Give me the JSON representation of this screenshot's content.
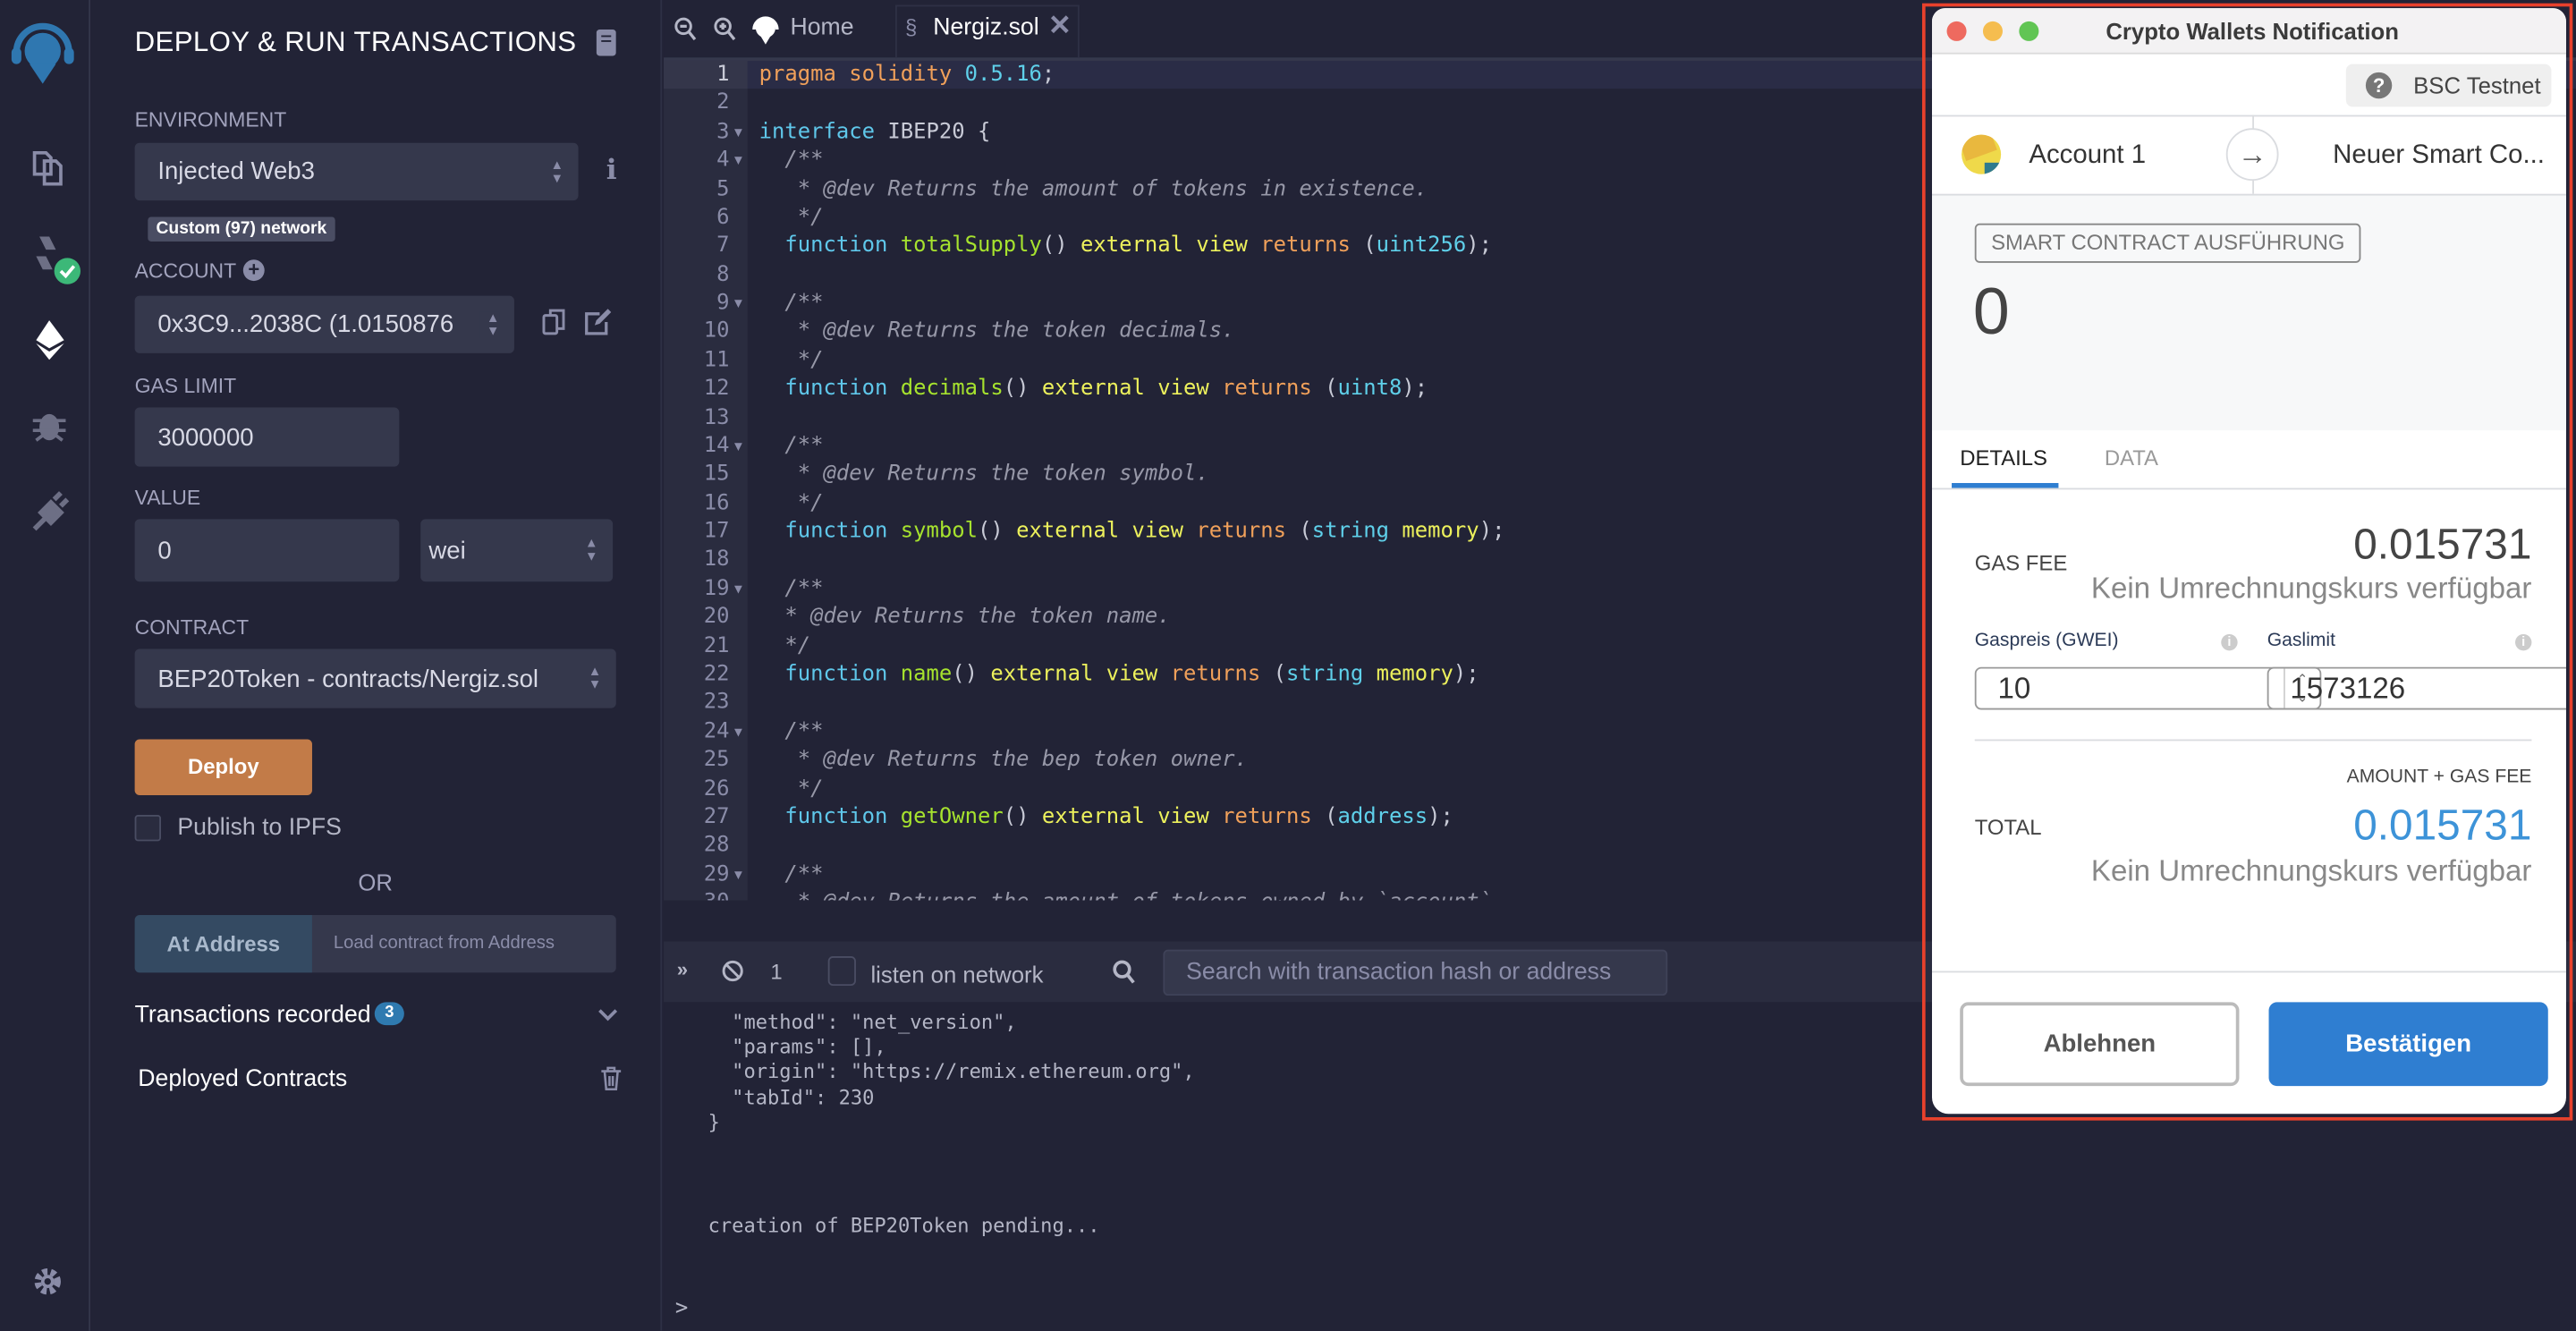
{
  "iconbar": {
    "icons": [
      "remix-logo-icon",
      "file-explorer-icon",
      "solidity-compiler-icon",
      "deploy-run-icon",
      "debugger-icon",
      "plugin-manager-icon",
      "settings-gear-icon"
    ]
  },
  "panel": {
    "title": "DEPLOY & RUN TRANSACTIONS",
    "environment_label": "ENVIRONMENT",
    "environment_value": "Injected Web3",
    "network_badge": "Custom (97) network",
    "account_label": "ACCOUNT",
    "account_value": "0x3C9...2038C (1.0150876",
    "gas_limit_label": "GAS LIMIT",
    "gas_limit_value": "3000000",
    "value_label": "VALUE",
    "value_value": "0",
    "value_unit": "wei",
    "contract_label": "CONTRACT",
    "contract_value": "BEP20Token - contracts/Nergiz.sol",
    "deploy_label": "Deploy",
    "publish_label": "Publish to IPFS",
    "or_label": "OR",
    "at_address_label": "At Address",
    "at_address_placeholder": "Load contract from Address",
    "transactions_label": "Transactions recorded",
    "transactions_count": "3",
    "deployed_label": "Deployed Contracts"
  },
  "tabs": {
    "home": "Home",
    "file": "Nergiz.sol"
  },
  "code": [
    [
      [
        "pragma solidity ",
        "k"
      ],
      [
        "0.5.16",
        "n"
      ],
      [
        ";",
        "p"
      ]
    ],
    [],
    [
      [
        "interface ",
        "b"
      ],
      [
        "IBEP20 {",
        "i"
      ]
    ],
    [
      [
        "  /**",
        "c"
      ]
    ],
    [
      [
        "   * @dev Returns the amount of tokens in existence.",
        "c"
      ]
    ],
    [
      [
        "   */",
        "c"
      ]
    ],
    [
      [
        "  function ",
        "b"
      ],
      [
        "totalSupply",
        "f"
      ],
      [
        "() ",
        "p"
      ],
      [
        "external view ",
        "y"
      ],
      [
        "returns ",
        "k"
      ],
      [
        "(",
        "p"
      ],
      [
        "uint256",
        "t"
      ],
      [
        ");",
        "p"
      ]
    ],
    [],
    [
      [
        "  /**",
        "c"
      ]
    ],
    [
      [
        "   * @dev Returns the token decimals.",
        "c"
      ]
    ],
    [
      [
        "   */",
        "c"
      ]
    ],
    [
      [
        "  function ",
        "b"
      ],
      [
        "decimals",
        "f"
      ],
      [
        "() ",
        "p"
      ],
      [
        "external view ",
        "y"
      ],
      [
        "returns ",
        "k"
      ],
      [
        "(",
        "p"
      ],
      [
        "uint8",
        "t"
      ],
      [
        ");",
        "p"
      ]
    ],
    [],
    [
      [
        "  /**",
        "c"
      ]
    ],
    [
      [
        "   * @dev Returns the token symbol.",
        "c"
      ]
    ],
    [
      [
        "   */",
        "c"
      ]
    ],
    [
      [
        "  function ",
        "b"
      ],
      [
        "symbol",
        "f"
      ],
      [
        "() ",
        "p"
      ],
      [
        "external view ",
        "y"
      ],
      [
        "returns ",
        "k"
      ],
      [
        "(",
        "p"
      ],
      [
        "string ",
        "t"
      ],
      [
        "memory",
        "y"
      ],
      [
        ");",
        "p"
      ]
    ],
    [],
    [
      [
        "  /**",
        "c"
      ]
    ],
    [
      [
        "  * @dev Returns the token name.",
        "c"
      ]
    ],
    [
      [
        "  */",
        "c"
      ]
    ],
    [
      [
        "  function ",
        "b"
      ],
      [
        "name",
        "f"
      ],
      [
        "() ",
        "p"
      ],
      [
        "external view ",
        "y"
      ],
      [
        "returns ",
        "k"
      ],
      [
        "(",
        "p"
      ],
      [
        "string ",
        "t"
      ],
      [
        "memory",
        "y"
      ],
      [
        ");",
        "p"
      ]
    ],
    [],
    [
      [
        "  /**",
        "c"
      ]
    ],
    [
      [
        "   * @dev Returns the bep token owner.",
        "c"
      ]
    ],
    [
      [
        "   */",
        "c"
      ]
    ],
    [
      [
        "  function ",
        "b"
      ],
      [
        "getOwner",
        "f"
      ],
      [
        "() ",
        "p"
      ],
      [
        "external view ",
        "y"
      ],
      [
        "returns ",
        "k"
      ],
      [
        "(",
        "p"
      ],
      [
        "address",
        "t"
      ],
      [
        ");",
        "p"
      ]
    ],
    [],
    [
      [
        "  /**",
        "c"
      ]
    ],
    [
      [
        "   * @dev Returns the amount of tokens owned by `account`.",
        "c"
      ]
    ]
  ],
  "folds": [
    3,
    4,
    9,
    14,
    19,
    24,
    29
  ],
  "terminal": {
    "count": "1",
    "listen_label": "listen on network",
    "search_placeholder": "Search with transaction hash or address",
    "lines": [
      "  \"method\": \"net_version\",",
      "  \"params\": [],",
      "  \"origin\": \"https://remix.ethereum.org\",",
      "  \"tabId\": 230",
      "}"
    ],
    "pending": "creation of BEP20Token pending...",
    "prompt": ">"
  },
  "wallet": {
    "window_title": "Crypto Wallets Notification",
    "network": "BSC Testnet",
    "from": "Account 1",
    "to": "Neuer Smart Co...",
    "action_badge": "SMART CONTRACT AUSFÜHRUNG",
    "amount": "0",
    "tab_details": "DETAILS",
    "tab_data": "DATA",
    "gas_fee_label": "GAS FEE",
    "gas_fee_value": "0.015731",
    "no_rate": "Kein Umrechnungskurs verfügbar",
    "gas_price_label": "Gaspreis (GWEI)",
    "gas_price_value": "10",
    "gas_limit_label": "Gaslimit",
    "gas_limit_value": "1573126",
    "amount_plus_fee": "AMOUNT + GAS FEE",
    "total_label": "TOTAL",
    "total_value": "0.015731",
    "reject_label": "Ablehnen",
    "confirm_label": "Bestätigen",
    "colors": {
      "confirm": "#2f7ed1",
      "total": "#3d93d8",
      "highlight_border": "#e8412c"
    }
  }
}
